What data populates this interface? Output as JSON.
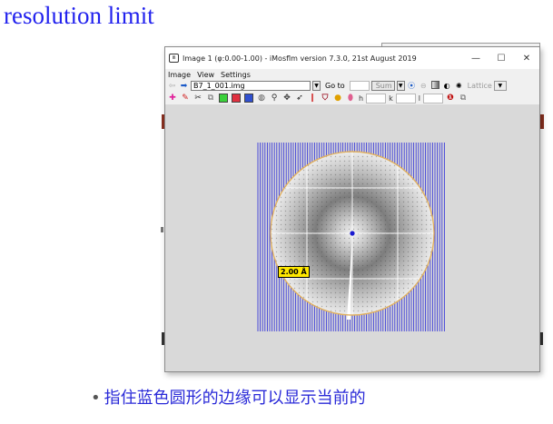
{
  "slide": {
    "title": "resolution limit",
    "bullet": "指住蓝色圆形的边缘可以显示当前的"
  },
  "window": {
    "title": "Image 1 (φ:0.00-1.00) - iMosflm version 7.3.0, 21st August 2019",
    "app_icon": "m",
    "minimize": "—",
    "maximize": "☐",
    "close": "✕"
  },
  "menu": [
    "Image",
    "View",
    "Settings"
  ],
  "toolbar": {
    "back": "⇦",
    "forward": "➡",
    "file": "B7_1_001.img",
    "goto_label": "Go to",
    "sum_value": "Sum",
    "lattice_label": "Lattice"
  },
  "hkl": {
    "h": "h",
    "k": "k",
    "l": "l"
  },
  "resolution_label": "2.00 Å",
  "colors": {
    "title_blue": "#2222ee",
    "bullet_blue": "#2a2ad8",
    "stripe_blue": "#3b3bd9",
    "circle": "#e0b060",
    "label_bg": "#ffe800"
  }
}
